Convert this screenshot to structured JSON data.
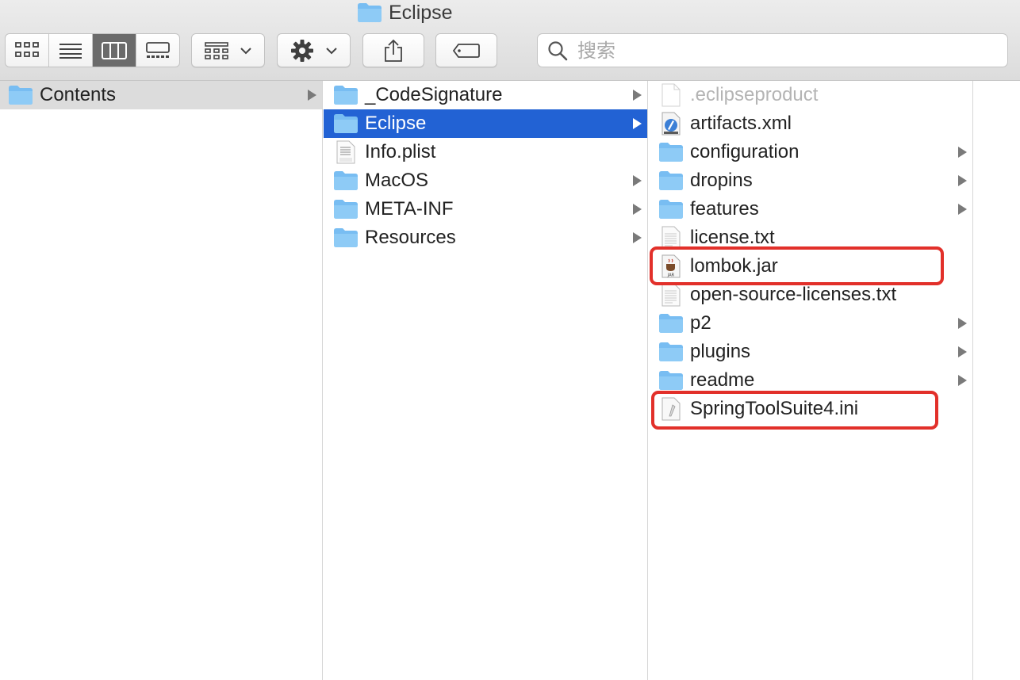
{
  "window": {
    "title": "Eclipse"
  },
  "toolbar": {
    "view_buttons": [
      {
        "name": "icon-view",
        "icon": "grid-icon",
        "active": false
      },
      {
        "name": "list-view",
        "icon": "list-icon",
        "active": false
      },
      {
        "name": "column-view",
        "icon": "columns-icon",
        "active": true
      },
      {
        "name": "gallery-view",
        "icon": "gallery-icon",
        "active": false
      }
    ],
    "group_button_icon": "group-grid-icon",
    "action_button_icon": "gear-icon",
    "share_button_icon": "share-icon",
    "tag_button_icon": "tag-icon",
    "search": {
      "placeholder": "搜索",
      "value": ""
    }
  },
  "columns": {
    "col1": {
      "items": [
        {
          "name": "Contents",
          "type": "folder",
          "has_children": true,
          "state": "parent"
        }
      ]
    },
    "col2": {
      "items": [
        {
          "name": "_CodeSignature",
          "type": "folder",
          "has_children": true
        },
        {
          "name": "Eclipse",
          "type": "folder",
          "has_children": true,
          "state": "selected"
        },
        {
          "name": "Info.plist",
          "type": "plist",
          "has_children": false
        },
        {
          "name": "MacOS",
          "type": "folder",
          "has_children": true
        },
        {
          "name": "META-INF",
          "type": "folder",
          "has_children": true
        },
        {
          "name": "Resources",
          "type": "folder",
          "has_children": true
        }
      ]
    },
    "col3": {
      "items": [
        {
          "name": ".eclipseproduct",
          "type": "file",
          "has_children": false,
          "state": "hidden"
        },
        {
          "name": "artifacts.xml",
          "type": "xml",
          "has_children": false
        },
        {
          "name": "configuration",
          "type": "folder",
          "has_children": true
        },
        {
          "name": "dropins",
          "type": "folder",
          "has_children": true
        },
        {
          "name": "features",
          "type": "folder",
          "has_children": true
        },
        {
          "name": "license.txt",
          "type": "text",
          "has_children": false
        },
        {
          "name": "lombok.jar",
          "type": "jar",
          "has_children": false,
          "annotated": true
        },
        {
          "name": "open-source-licenses.txt",
          "type": "text",
          "has_children": false
        },
        {
          "name": "p2",
          "type": "folder",
          "has_children": true
        },
        {
          "name": "plugins",
          "type": "folder",
          "has_children": true
        },
        {
          "name": "readme",
          "type": "folder",
          "has_children": true
        },
        {
          "name": "SpringToolSuite4.ini",
          "type": "ini",
          "has_children": false,
          "annotated": true
        }
      ]
    }
  },
  "colors": {
    "selection": "#2262d4",
    "annotation": "#e2302a",
    "folder": "#6cb8f0"
  }
}
